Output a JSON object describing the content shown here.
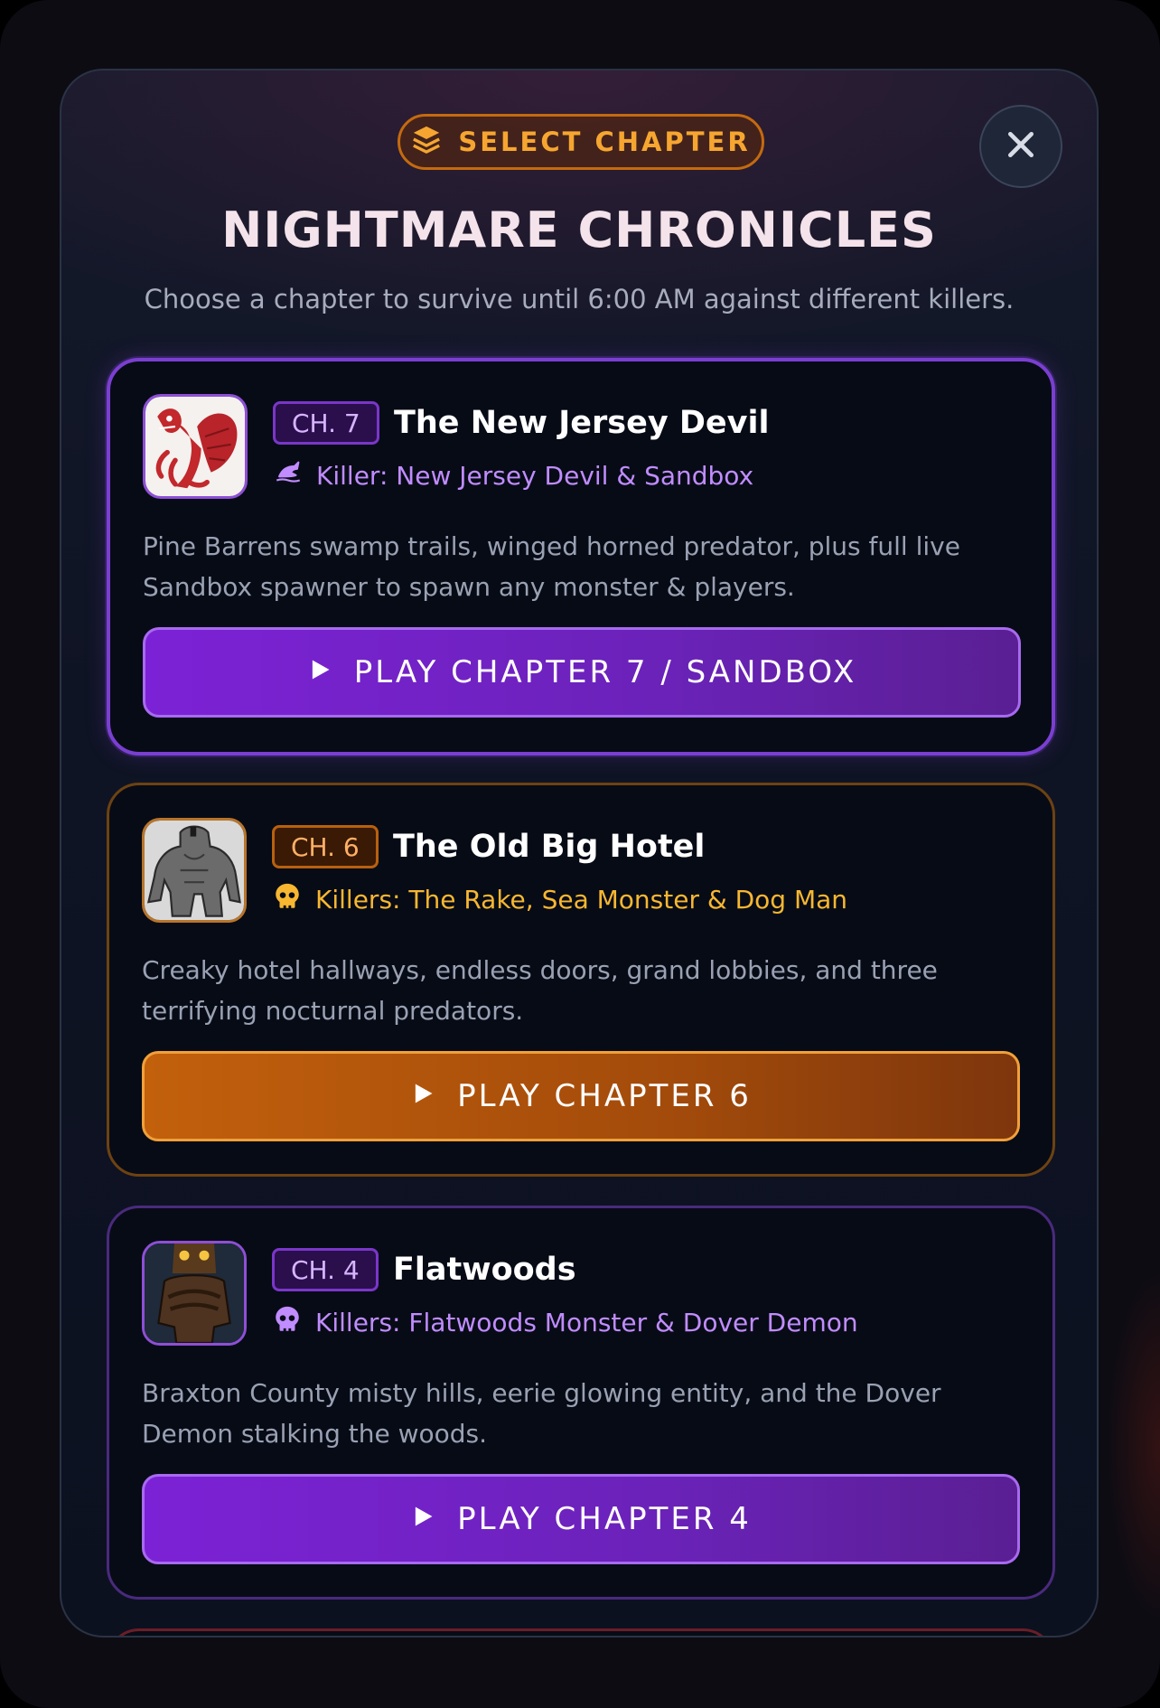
{
  "header": {
    "pill_label": "SELECT CHAPTER",
    "title": "NIGHTMARE CHRONICLES",
    "subtitle": "Choose a chapter to survive until 6:00 AM against different killers."
  },
  "chapters": [
    {
      "badge": "CH. 7",
      "title": "The New Jersey Devil",
      "killer": "Killer: New Jersey Devil & Sandbox",
      "killer_icon": "dragon-icon",
      "description": "Pine Barrens swamp trails, winged horned predator, plus full live Sandbox spawner to spawn any monster & players.",
      "play_label": "PLAY CHAPTER 7 / SANDBOX",
      "theme": "purple",
      "accent": "#7c22d6"
    },
    {
      "badge": "CH. 6",
      "title": "The Old Big Hotel",
      "killer": "Killers: The Rake, Sea Monster & Dog Man",
      "killer_icon": "skull-icon",
      "description": "Creaky hotel hallways, endless doors, grand lobbies, and three terrifying nocturnal predators.",
      "play_label": "PLAY CHAPTER 6",
      "theme": "orange",
      "accent": "#c2600c"
    },
    {
      "badge": "CH. 4",
      "title": "Flatwoods",
      "killer": "Killers: Flatwoods Monster & Dover Demon",
      "killer_icon": "skull-icon",
      "description": "Braxton County misty hills, eerie glowing entity, and the Dover Demon stalking the woods.",
      "play_label": "PLAY CHAPTER 4",
      "theme": "purple",
      "accent": "#7c22d6"
    }
  ]
}
